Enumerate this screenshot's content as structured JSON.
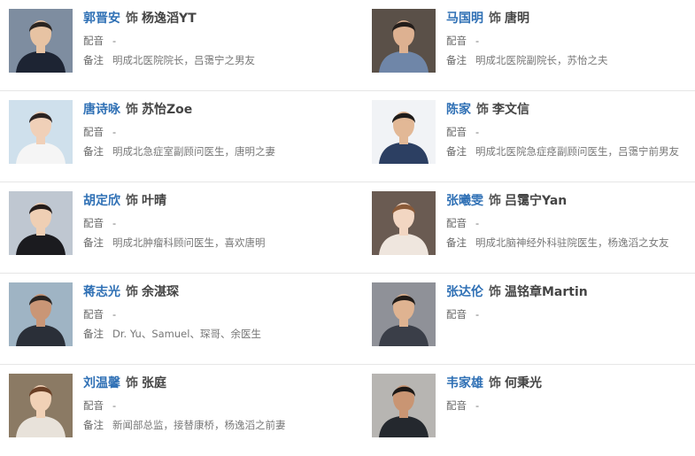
{
  "labels": {
    "as": "饰",
    "voice": "配音",
    "note": "备注"
  },
  "cast": [
    {
      "actor": "郭晋安",
      "role": "杨逸滔YT",
      "voice": "-",
      "note": "明成北医院院长，吕霭宁之男友",
      "photo": {
        "bg": "#7e8da0",
        "skin": "#e7c3a3",
        "hair": "#2a2420",
        "cloth": "#1d2433"
      }
    },
    {
      "actor": "马国明",
      "role": "唐明",
      "voice": "-",
      "note": "明成北医院副院长，苏怡之夫",
      "photo": {
        "bg": "#5a5048",
        "skin": "#ddb191",
        "hair": "#231d1a",
        "cloth": "#6f86a8"
      }
    },
    {
      "actor": "唐诗咏",
      "role": "苏怡Zoe",
      "voice": "-",
      "note": "明成北急症室副顾问医生，唐明之妻",
      "photo": {
        "bg": "#cfe0ec",
        "skin": "#f0d0b8",
        "hair": "#2b2322",
        "cloth": "#f5f5f5"
      }
    },
    {
      "actor": "陈家",
      "role": "李文信",
      "voice": "-",
      "note": "明成北医院急症痉副顾问医生，吕霭宁前男友",
      "photo": {
        "bg": "#f1f3f6",
        "skin": "#e2b896",
        "hair": "#1e1b1a",
        "cloth": "#2c3f62"
      }
    },
    {
      "actor": "胡定欣",
      "role": "叶晴",
      "voice": "-",
      "note": "明成北肿瘤科顾问医生，喜欢唐明",
      "photo": {
        "bg": "#bfc7d1",
        "skin": "#efcfb4",
        "hair": "#241c1a",
        "cloth": "#1b1b1f"
      }
    },
    {
      "actor": "张曦雯",
      "role": "吕霭宁Yan",
      "voice": "-",
      "note": "明成北脑神经外科驻院医生，杨逸滔之女友",
      "photo": {
        "bg": "#6a5b52",
        "skin": "#f2d6c2",
        "hair": "#8a5a38",
        "cloth": "#efe6de"
      }
    },
    {
      "actor": "蒋志光",
      "role": "余湛琛",
      "voice": "-",
      "note": "Dr. Yu、Samuel、琛哥、余医生",
      "photo": {
        "bg": "#9fb4c4",
        "skin": "#c99676",
        "hair": "#2a2522",
        "cloth": "#2a2f38"
      }
    },
    {
      "actor": "张达伦",
      "role": "温铭章Martin",
      "voice": "-",
      "note": "",
      "photo": {
        "bg": "#8f9198",
        "skin": "#dfb391",
        "hair": "#221c18",
        "cloth": "#3a3e48"
      }
    },
    {
      "actor": "刘温馨",
      "role": "张庭",
      "voice": "-",
      "note": "新闻部总监，接替康桥，杨逸滔之前妻",
      "photo": {
        "bg": "#8b7a64",
        "skin": "#f1d1b6",
        "hair": "#6a3f25",
        "cloth": "#e8e2da"
      }
    },
    {
      "actor": "韦家雄",
      "role": "何秉光",
      "voice": "-",
      "note": "",
      "photo": {
        "bg": "#b7b5b2",
        "skin": "#c99573",
        "hair": "#1c1816",
        "cloth": "#24282e"
      }
    }
  ]
}
